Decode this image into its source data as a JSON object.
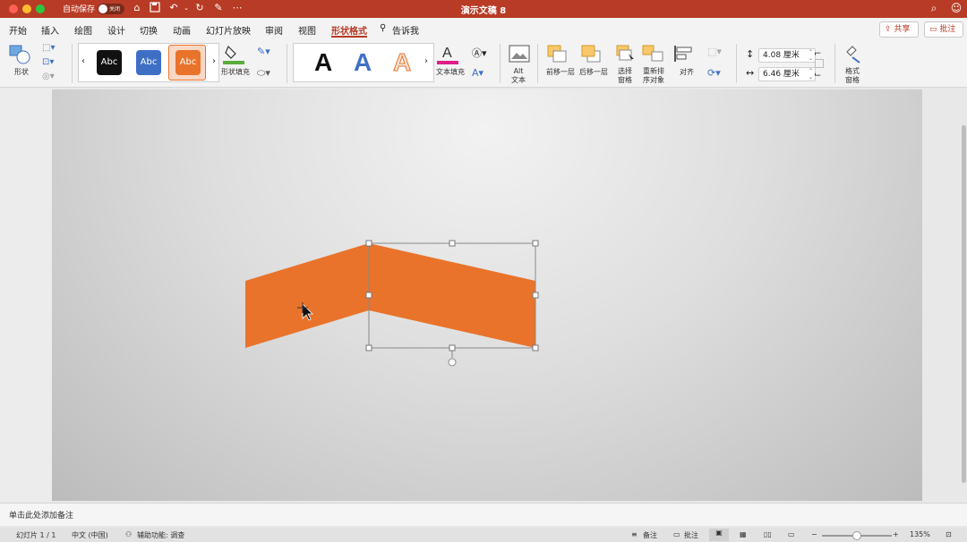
{
  "titlebar": {
    "autosave_label": "自动保存",
    "autosave_state": "关闭",
    "document_title": "演示文稿 8"
  },
  "menu": {
    "tabs": [
      "开始",
      "插入",
      "绘图",
      "设计",
      "切换",
      "动画",
      "幻灯片放映",
      "审阅",
      "视图",
      "形状格式",
      "告诉我"
    ],
    "active_tab": "形状格式",
    "share_label": "共享",
    "comment_label": "批注"
  },
  "ribbon": {
    "shape_label": "形状",
    "style_swatches": [
      "Abc",
      "Abc",
      "Abc"
    ],
    "shape_fill_label": "形状填充",
    "text_fill_label": "文本填充",
    "alt_text_label": "Alt\n文本",
    "bring_forward_label": "前移一层",
    "send_backward_label": "后移一层",
    "selection_pane_label": "选择\n窗格",
    "reorder_label": "重新排\n序对象",
    "align_label": "对齐",
    "height_value": "4.08 厘米",
    "width_value": "6.46 厘米",
    "format_pane_label": "格式\n窗格",
    "wordart_letters": [
      "A",
      "A",
      "A"
    ]
  },
  "notes": {
    "placeholder": "单击此处添加备注"
  },
  "statusbar": {
    "slide_info": "幻灯片 1 / 1",
    "language": "中文 (中国)",
    "accessibility": "辅助功能: 调查",
    "notes_label": "备注",
    "comments_label": "批注",
    "zoom": "135%"
  },
  "colors": {
    "titlebar": "#b83b26",
    "shape_orange": "#e9732b",
    "accent": "#b83b26"
  }
}
